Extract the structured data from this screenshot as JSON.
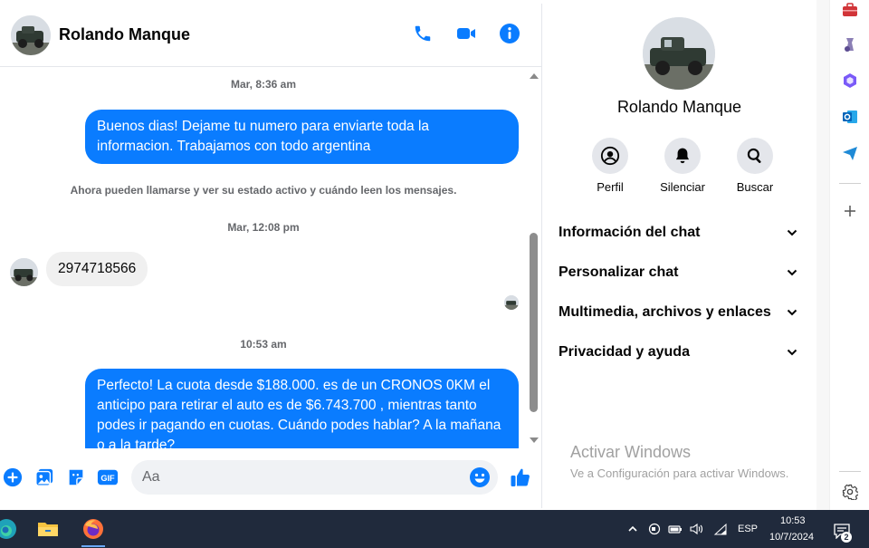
{
  "contact": {
    "name": "Rolando Manque"
  },
  "messages": {
    "ts1": "Mar, 8:36 am",
    "msg1": "Buenos dias! Dejame tu numero para enviarte toda la informacion. Trabajamos con todo argentina",
    "notice": "Ahora pueden llamarse y ver su estado activo y cuándo leen los mensajes.",
    "ts2": "Mar, 12:08 pm",
    "msg2": "2974718566",
    "ts3": "10:53 am",
    "msg3": "Perfecto! La cuota desde $188.000. es de un CRONOS 0KM el anticipo para retirar el auto es de $6.743.700 , mientras tanto podes ir pagando en cuotas. Cuándo podes hablar? A la mañana o a la tarde?"
  },
  "composer": {
    "placeholder": "Aa"
  },
  "info": {
    "actions": [
      {
        "label": "Perfil",
        "icon": "profile-icon"
      },
      {
        "label": "Silenciar",
        "icon": "bell-icon"
      },
      {
        "label": "Buscar",
        "icon": "search-icon"
      }
    ],
    "sections": [
      "Información del chat",
      "Personalizar chat",
      "Multimedia, archivos y enlaces",
      "Privacidad y ayuda"
    ]
  },
  "watermark": {
    "title": "Activar Windows",
    "subtitle": "Ve a Configuración para activar Windows."
  },
  "taskbar": {
    "language": "ESP",
    "time": "10:53",
    "date": "10/7/2024",
    "notifications": "2"
  },
  "colors": {
    "accent": "#0a7cff",
    "taskbar": "#202a3c"
  }
}
